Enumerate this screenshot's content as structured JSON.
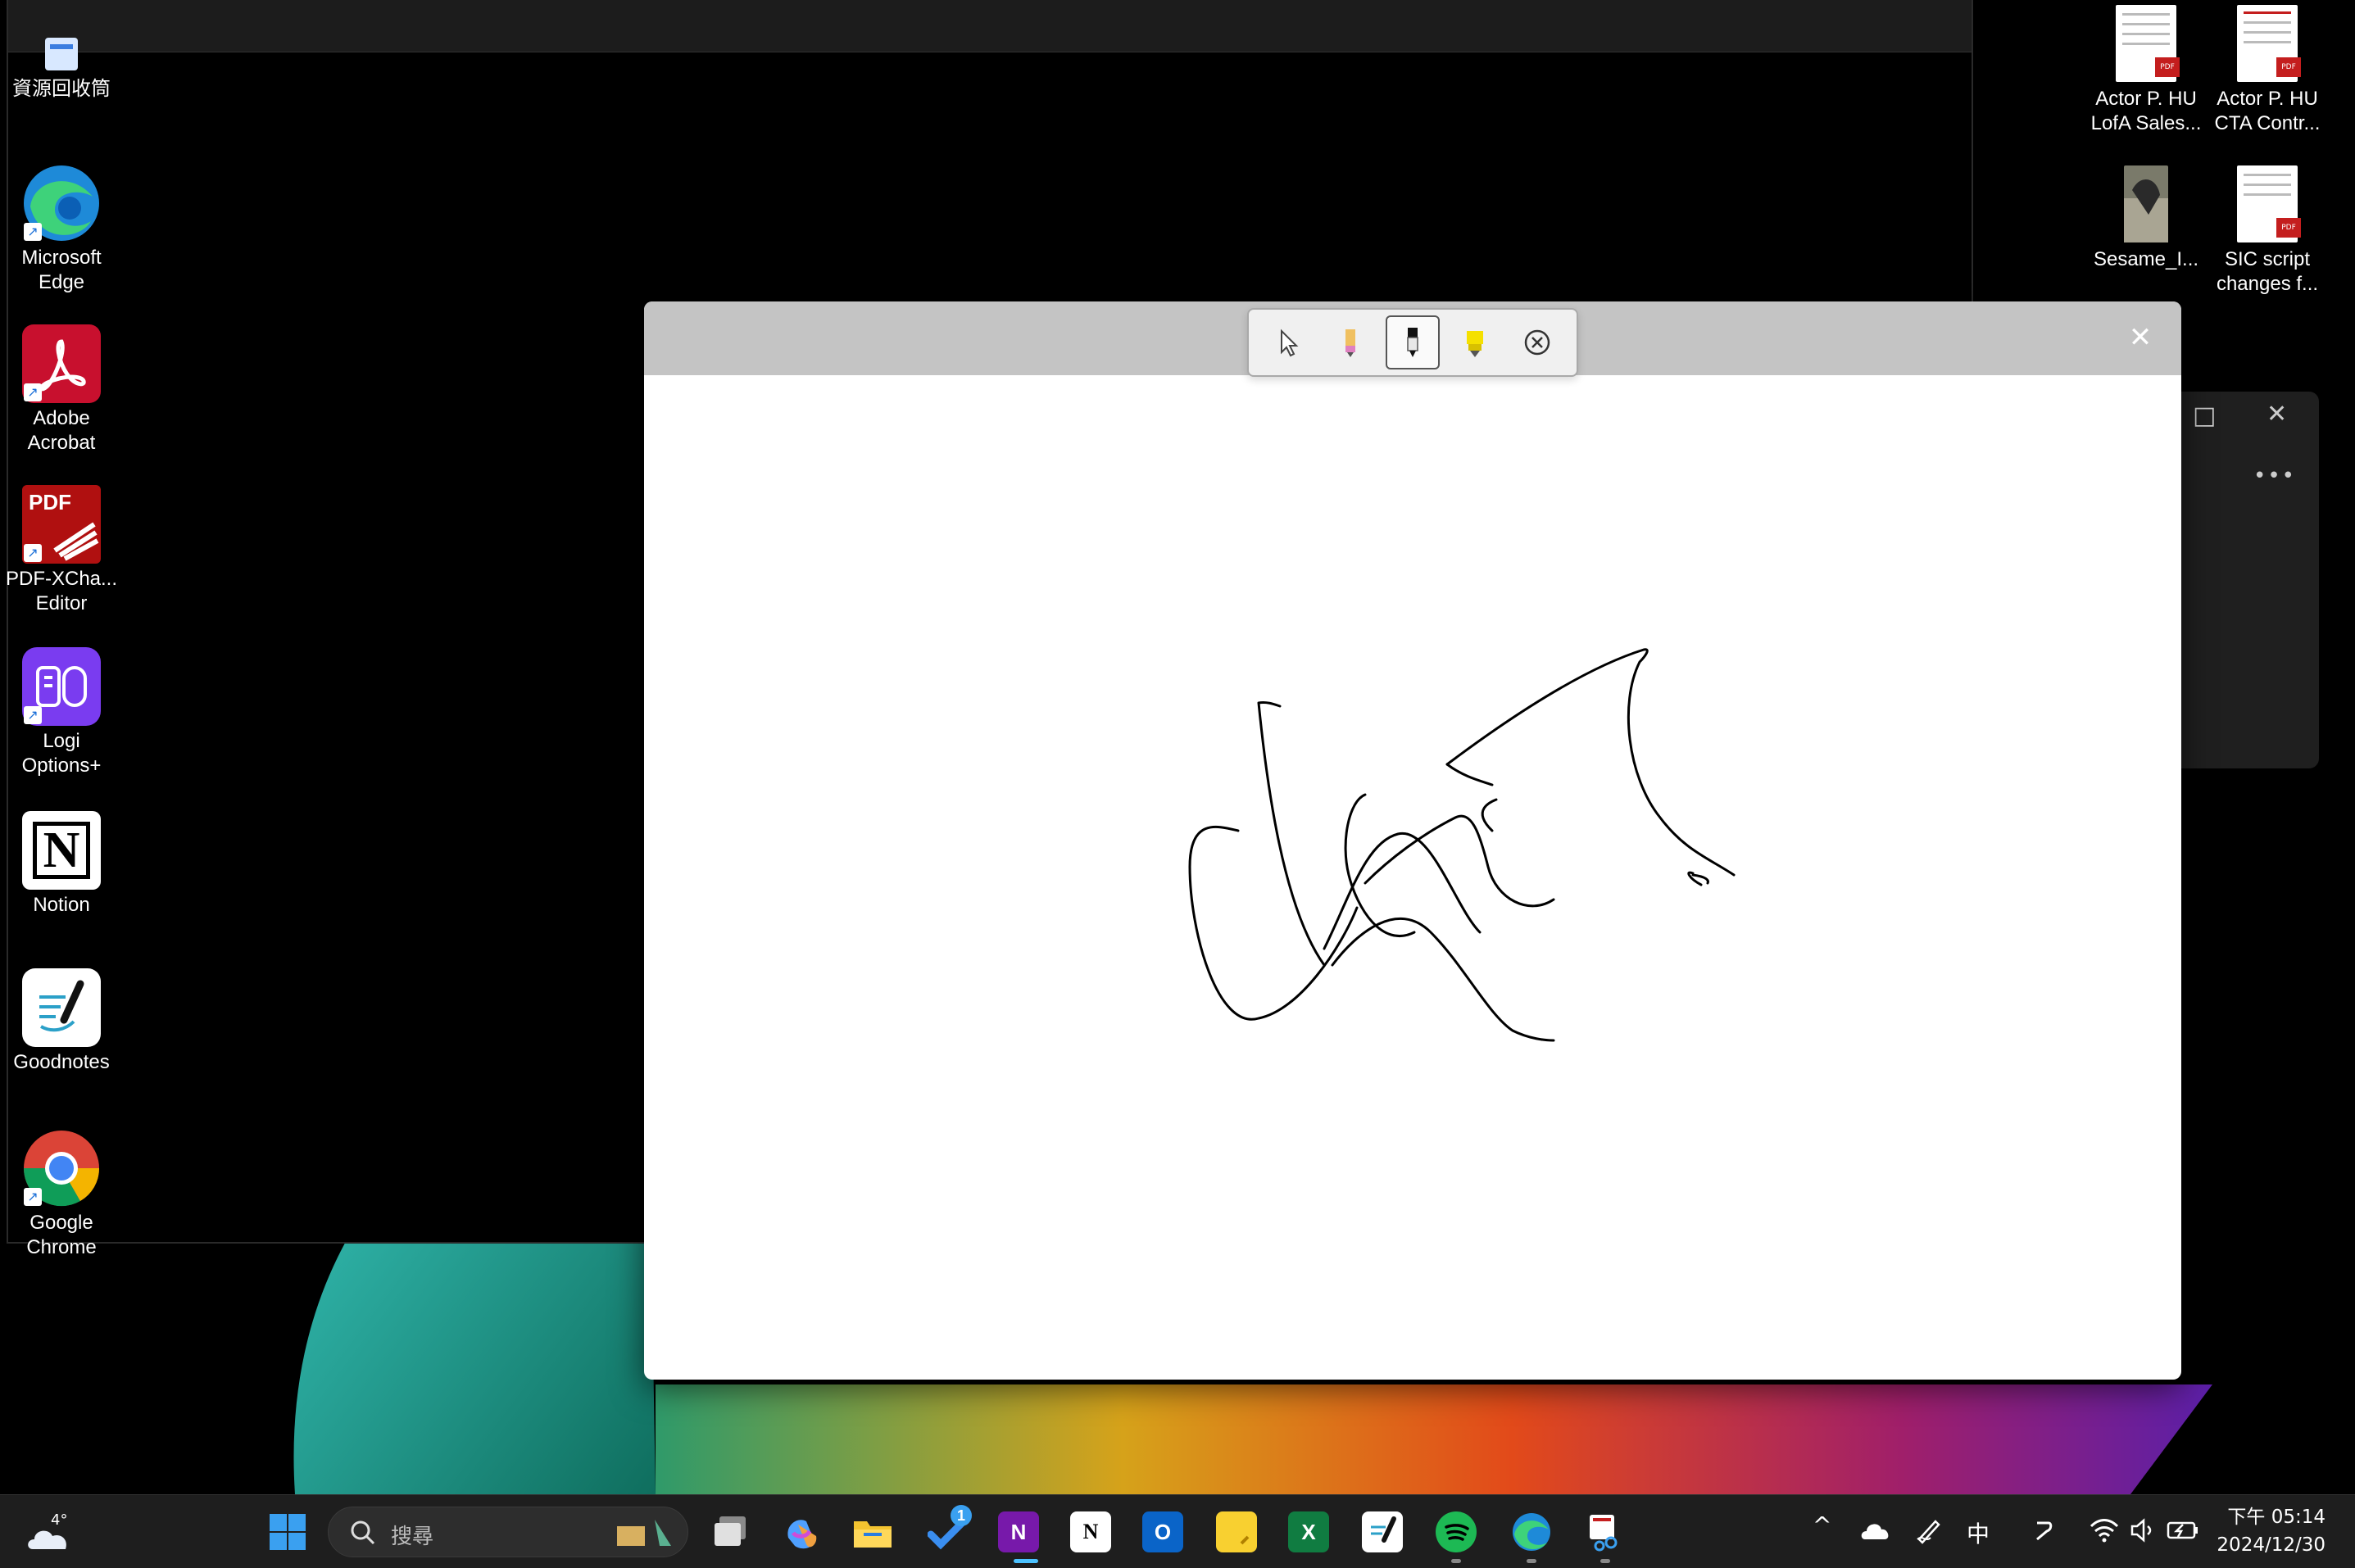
{
  "desktop": {
    "left_icons": [
      {
        "label": "資源回收筒",
        "icon": "recycle-bin-icon"
      },
      {
        "label": "Microsoft\nEdge",
        "icon": "edge-icon"
      },
      {
        "label": "Adobe\nAcrobat",
        "icon": "acrobat-icon"
      },
      {
        "label": "PDF-XCha...\nEditor",
        "icon": "pdf-xchange-icon",
        "badge": "PDF"
      },
      {
        "label": "Logi\nOptions+",
        "icon": "logi-options-icon"
      },
      {
        "label": "Notion",
        "icon": "notion-icon",
        "badge": "N"
      },
      {
        "label": "Goodnotes",
        "icon": "goodnotes-icon"
      },
      {
        "label": "Google\nChrome",
        "icon": "chrome-icon"
      }
    ],
    "right_icons": [
      {
        "label": "Actor P. HU\nLofA Sales...",
        "icon": "pdf-file-icon",
        "badge": "PDF"
      },
      {
        "label": "Actor P. HU\nCTA Contr...",
        "icon": "pdf-file-icon",
        "badge": "PDF"
      },
      {
        "label": "Sesame_I...",
        "icon": "image-file-icon"
      },
      {
        "label": "SIC script\nchanges f...",
        "icon": "pdf-file-icon",
        "badge": "PDF"
      }
    ]
  },
  "whiteboard": {
    "tools": [
      {
        "name": "select",
        "icon": "cursor-icon",
        "active": false
      },
      {
        "name": "eraser-pen",
        "icon": "pink-pen-icon",
        "active": false
      },
      {
        "name": "pen",
        "icon": "black-pen-icon",
        "active": true
      },
      {
        "name": "highlighter",
        "icon": "yellow-highlighter-icon",
        "active": false
      },
      {
        "name": "clear",
        "icon": "clear-circle-x-icon",
        "active": false
      }
    ],
    "close_label": "✕"
  },
  "side_panel": {
    "more_label": "•••"
  },
  "taskbar": {
    "weather_temp": "4°",
    "search_placeholder": "搜尋",
    "apps": [
      {
        "icon": "file-explorer-icon"
      },
      {
        "icon": "copilot-icon"
      },
      {
        "icon": "folder-icon"
      },
      {
        "icon": "todo-icon",
        "badge": "1"
      },
      {
        "icon": "onenote-icon",
        "letter": "N"
      },
      {
        "icon": "notion-icon",
        "letter": "N"
      },
      {
        "icon": "outlook-icon",
        "letter": "O"
      },
      {
        "icon": "sticky-notes-icon"
      },
      {
        "icon": "excel-icon",
        "letter": "X"
      },
      {
        "icon": "goodnotes-icon"
      },
      {
        "icon": "spotify-icon"
      },
      {
        "icon": "edge-icon"
      },
      {
        "icon": "snipping-tool-icon"
      }
    ],
    "tray": {
      "ime": "中",
      "time": "下午 05:14",
      "date": "2024/12/30"
    }
  },
  "colors": {
    "accent": "#0078d4",
    "titlebar": "#c4c4c4",
    "taskbar": "#1e1e1e"
  }
}
